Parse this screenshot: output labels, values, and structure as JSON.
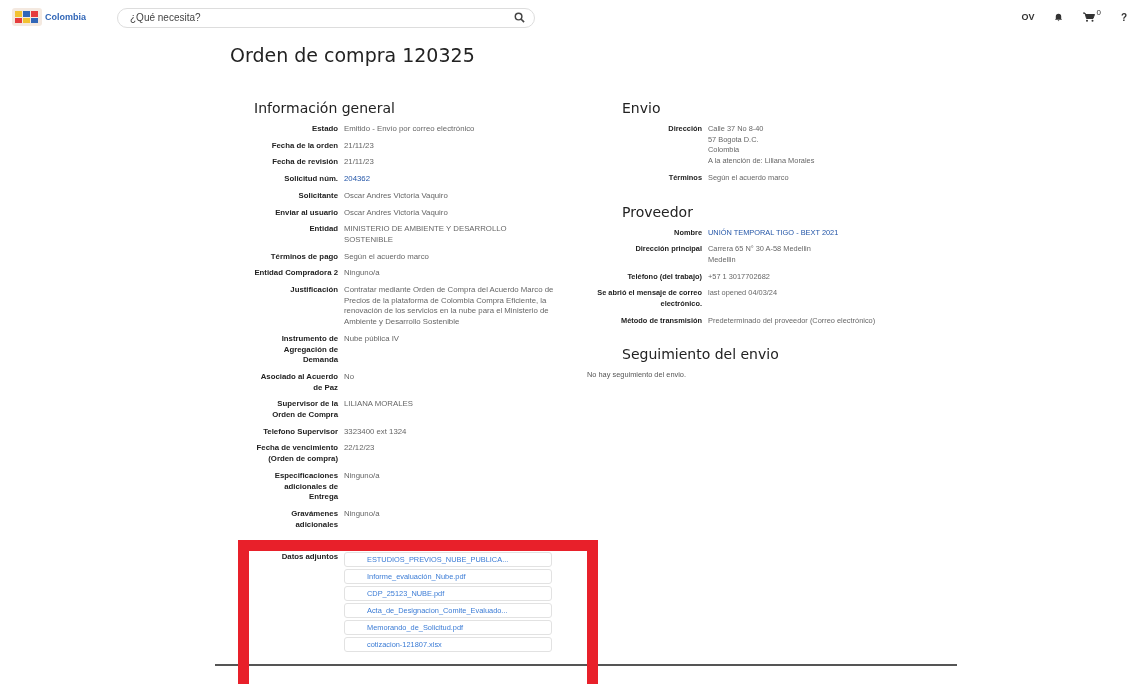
{
  "header": {
    "logo_text": "Colombia",
    "search": {
      "placeholder": "¿Qué necesita?"
    },
    "user_initials": "OV",
    "cart_count": "0",
    "help": "?"
  },
  "title": "Orden de compra 120325",
  "general_info": {
    "title": "Información general",
    "fields": [
      {
        "label": "Estado",
        "kind": "text",
        "lines": [
          "Emitido - Envío por correo electrónico"
        ]
      },
      {
        "label": "Fecha de la orden",
        "kind": "text",
        "lines": [
          "21/11/23"
        ]
      },
      {
        "label": "Fecha de revisión",
        "kind": "text",
        "lines": [
          "21/11/23"
        ]
      },
      {
        "label": "Solicitud núm.",
        "kind": "link",
        "lines": [
          "204362"
        ]
      },
      {
        "label": "Solicitante",
        "kind": "text",
        "lines": [
          "Oscar Andres Victoria Vaquiro"
        ]
      },
      {
        "label": "Enviar al usuario",
        "kind": "text",
        "lines": [
          "Oscar Andres Victoria Vaquiro"
        ]
      },
      {
        "label": "Entidad",
        "kind": "text",
        "lines": [
          "MINISTERIO DE AMBIENTE Y DESARROLLO SOSTENIBLE"
        ]
      },
      {
        "label": "Términos de pago",
        "kind": "text",
        "lines": [
          "Según el acuerdo marco"
        ]
      },
      {
        "label": "Entidad Compradora 2",
        "kind": "text",
        "lines": [
          "Ninguno/a"
        ]
      },
      {
        "label": "Justificación",
        "kind": "text",
        "lines": [
          "Contratar mediante Orden de Compra del Acuerdo Marco de Precios de la plataforma de Colombia Compra Eficiente, la renovación de los servicios en la nube para el Ministerio de Ambiente y Desarrollo Sostenible"
        ]
      },
      {
        "label": "Instrumento de Agregación de Demanda",
        "kind": "text",
        "lines": [
          "Nube pública IV"
        ]
      },
      {
        "label": "Asociado al Acuerdo de Paz",
        "kind": "text",
        "lines": [
          "No"
        ]
      },
      {
        "label": "Supervisor de la Orden de Compra",
        "kind": "text",
        "lines": [
          "LILIANA MORALES"
        ]
      },
      {
        "label": "Telefono Supervisor",
        "kind": "text",
        "lines": [
          "3323400 ext 1324"
        ]
      },
      {
        "label": "Fecha de vencimiento (Orden de compra)",
        "kind": "text",
        "lines": [
          "22/12/23"
        ]
      },
      {
        "label": "Especificaciones adicionales de Entrega",
        "kind": "text",
        "lines": [
          "Ninguno/a"
        ]
      },
      {
        "label": "Gravámenes adicionales",
        "kind": "text",
        "lines": [
          "Ninguno/a"
        ]
      }
    ]
  },
  "attachments": {
    "label": "Datos adjuntos",
    "files": [
      "ESTUDIOS_PREVIOS_NUBE_PUBLICA...",
      "Informe_evaluación_Nube.pdf",
      "CDP_25123_NUBE.pdf",
      "Acta_de_Designacion_Comite_Evaluado...",
      "Memorando_de_Solicitud.pdf",
      "cotizacion-121807.xlsx"
    ]
  },
  "shipping": {
    "title": "Envio",
    "fields": [
      {
        "label": "Dirección",
        "kind": "text",
        "lines": [
          "Calle 37 No 8-40",
          "57 Bogota D.C.",
          "Colombia",
          "A la atención de: Liliana Morales"
        ]
      },
      {
        "label": "Términos",
        "kind": "text",
        "lines": [
          "Según el acuerdo marco"
        ]
      }
    ]
  },
  "supplier": {
    "title": "Proveedor",
    "fields": [
      {
        "label": "Nombre",
        "kind": "link",
        "lines": [
          "UNIÓN TEMPORAL TIGO - BEXT 2021"
        ]
      },
      {
        "label": "Dirección principal",
        "kind": "text",
        "lines": [
          "Carrera 65 N° 30 A-58 Medellin",
          "Medellin"
        ]
      },
      {
        "label": "Teléfono (del trabajo)",
        "kind": "text",
        "lines": [
          "+57 1 3017702682"
        ]
      },
      {
        "label": "Se abrió el mensaje de correo electrónico.",
        "kind": "text",
        "lines": [
          "last opened 04/03/24"
        ]
      },
      {
        "label": "Método de transmisión",
        "kind": "text",
        "lines": [
          "Predeterminado del proveedor (Correo electrónico)"
        ]
      }
    ]
  },
  "tracking": {
    "title": "Seguimiento del envio",
    "message": "No hay seguimiento del envio."
  }
}
